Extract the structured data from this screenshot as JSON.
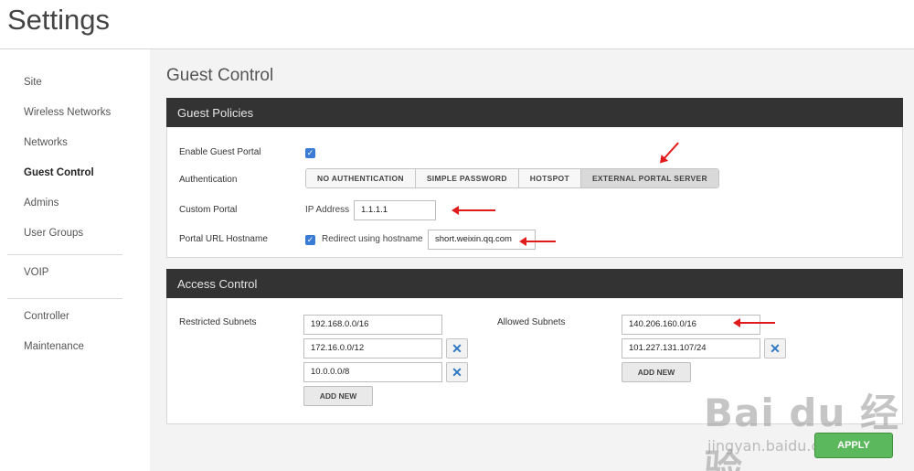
{
  "app": {
    "title": "Settings"
  },
  "sidebar": {
    "items": [
      {
        "label": "Site",
        "active": false
      },
      {
        "label": "Wireless Networks",
        "active": false
      },
      {
        "label": "Networks",
        "active": false
      },
      {
        "label": "Guest Control",
        "active": true
      },
      {
        "label": "Admins",
        "active": false
      },
      {
        "label": "User Groups",
        "active": false
      },
      {
        "label": "VOIP",
        "active": false
      },
      {
        "label": "Controller",
        "active": false
      },
      {
        "label": "Maintenance",
        "active": false
      }
    ]
  },
  "main": {
    "heading": "Guest Control",
    "guest_policies": {
      "title": "Guest Policies",
      "enable_guest_portal_label": "Enable Guest Portal",
      "enable_guest_portal_checked": true,
      "authentication_label": "Authentication",
      "auth_options": [
        "NO AUTHENTICATION",
        "SIMPLE PASSWORD",
        "HOTSPOT",
        "EXTERNAL PORTAL SERVER"
      ],
      "auth_selected": "EXTERNAL PORTAL SERVER",
      "custom_portal_label": "Custom Portal",
      "ip_address_label": "IP Address",
      "ip_address_value": "1.1.1.1",
      "portal_hostname_label": "Portal URL Hostname",
      "redirect_checked": true,
      "redirect_label": "Redirect using hostname",
      "hostname_value": "short.weixin.qq.com"
    },
    "access_control": {
      "title": "Access Control",
      "restricted_label": "Restricted Subnets",
      "restricted_subnets": [
        "192.168.0.0/16",
        "172.16.0.0/12",
        "10.0.0.0/8"
      ],
      "allowed_label": "Allowed Subnets",
      "allowed_subnets": [
        "140.206.160.0/16",
        "101.227.131.107/24"
      ],
      "add_new_label": "ADD NEW",
      "remove_icon": "close-icon"
    }
  },
  "footer": {
    "apply_label": "APPLY"
  },
  "watermark": {
    "text": "Bai du 经验",
    "sub": "jingyan.baidu.com"
  },
  "colors": {
    "panel_header": "#333333",
    "checkbox": "#3a7bd5",
    "annotation_arrow": "#e01b1b",
    "apply": "#5cb85c"
  }
}
